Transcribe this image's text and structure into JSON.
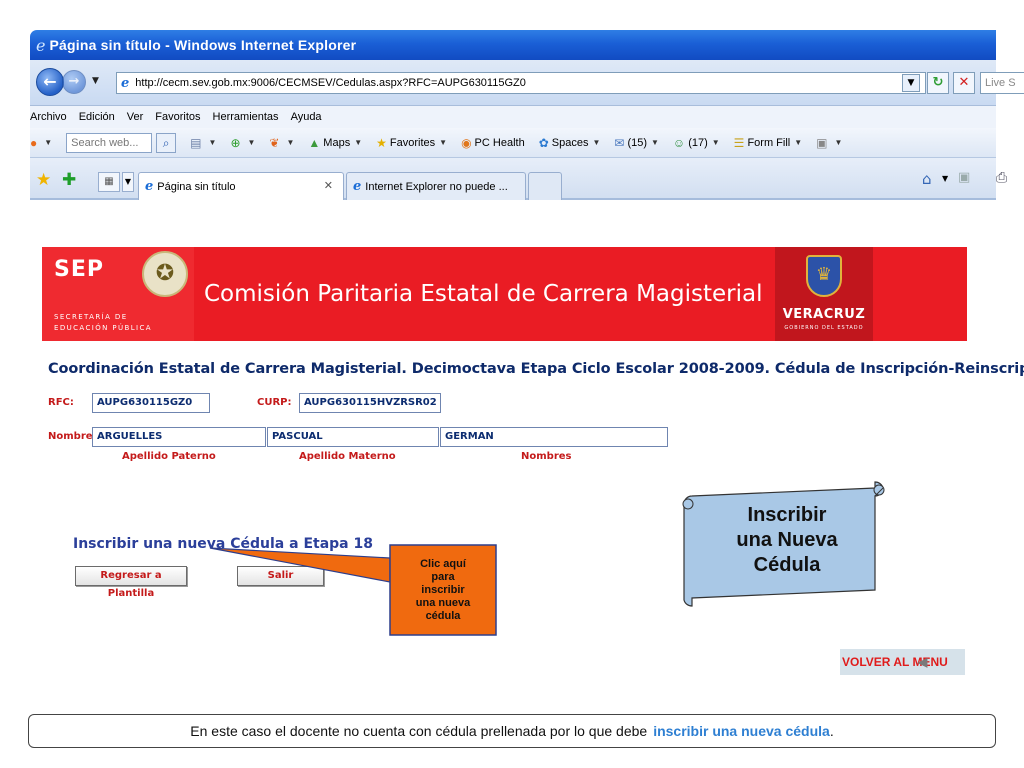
{
  "window": {
    "title": "Página sin título - Windows Internet Explorer",
    "url": "http://cecm.sev.gob.mx:9006/CECMSEV/Cedulas.aspx?RFC=AUPG630115GZ0",
    "search_placeholder": "Live S"
  },
  "menu": [
    "Archivo",
    "Edición",
    "Ver",
    "Favoritos",
    "Herramientas",
    "Ayuda"
  ],
  "toolbar": {
    "search_placeholder": "Search web...",
    "maps": "Maps",
    "favorites": "Favorites",
    "pc_health": "PC Health",
    "spaces": "Spaces",
    "mail_count": "(15)",
    "contacts_count": "(17)",
    "form_fill": "Form Fill"
  },
  "tabs": [
    {
      "label": "Página sin título"
    },
    {
      "label": "Internet Explorer no puede ..."
    }
  ],
  "banner": {
    "sep_logo": "SEP",
    "sep_sub1": "SECRETARÍA DE",
    "sep_sub2": "EDUCACIÓN PÚBLICA",
    "title": "Comisión Paritaria Estatal de Carrera Magisterial",
    "veracruz": "VERACRUZ",
    "veracruz_sub": "GOBIERNO DEL ESTADO"
  },
  "heading": "Coordinación Estatal de Carrera Magisterial. Decimoctava Etapa Ciclo Escolar 2008-2009. Cédula de Inscripción-Reinscripción",
  "form": {
    "rfc_label": "RFC:",
    "rfc_value": "AUPG630115GZ0",
    "curp_label": "CURP:",
    "curp_value": "AUPG630115HVZRSR02",
    "nombre_label": "Nombre:",
    "apellido_paterno": "ARGUELLES",
    "apellido_materno": "PASCUAL",
    "nombres": "GERMAN",
    "apellido_paterno_label": "Apellido Paterno",
    "apellido_materno_label": "Apellido Materno",
    "nombres_label": "Nombres"
  },
  "actions": {
    "new_cedula_link": "Inscribir una nueva Cédula a Etapa 18",
    "regresar": "Regresar a Plantilla",
    "salir": "Salir",
    "volver": "VOLVER AL MENU"
  },
  "callout": {
    "lines": [
      "Clic aquí",
      "para",
      "inscribir",
      "una nueva",
      "cédula"
    ],
    "color": "#f06a0f"
  },
  "scroll_note": {
    "lines": [
      "Inscribir",
      "una Nueva",
      "Cédula"
    ],
    "color": "#a9c8e6"
  },
  "note": {
    "text": "En este caso el docente no cuenta con cédula prellenada por lo que debe",
    "link": "inscribir una nueva cédula",
    "end": "."
  },
  "colors": {
    "banner_red": "#ea1c24",
    "heading_blue": "#0e2a6a",
    "label_red": "#c41a1a"
  }
}
